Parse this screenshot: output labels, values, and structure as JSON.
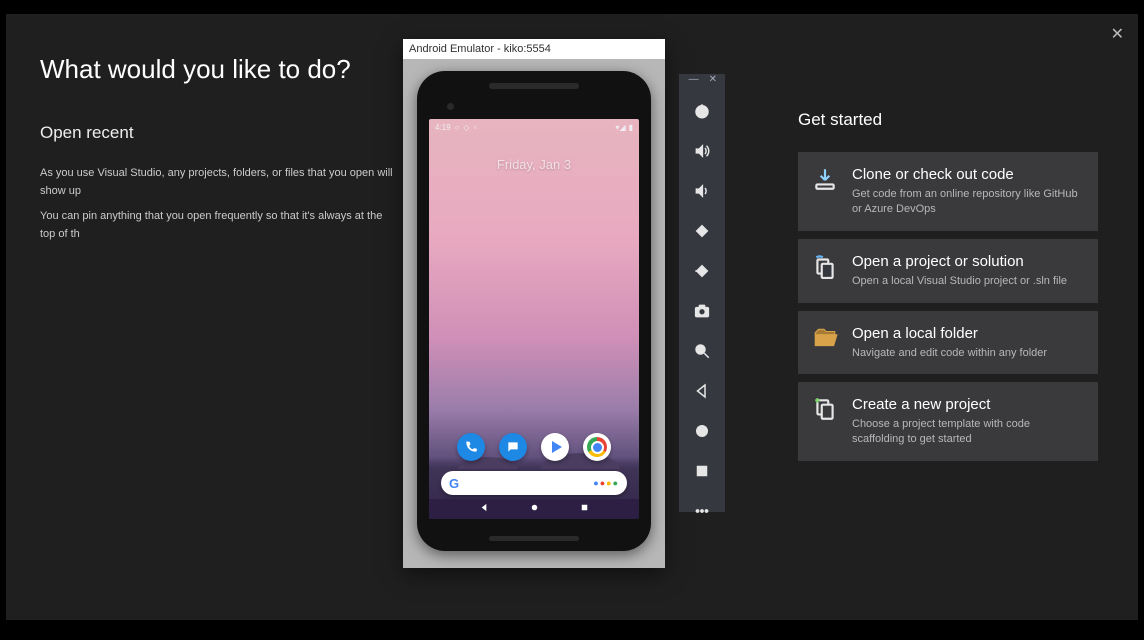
{
  "vs": {
    "title": "What would you like to do?",
    "recent_heading": "Open recent",
    "recent_p1": "As you use Visual Studio, any projects, folders, or files that you open will show up",
    "recent_p2": "You can pin anything that you open frequently so that it's always at the top of th",
    "get_started_heading": "Get started",
    "tiles": [
      {
        "title": "Clone or check out code",
        "sub": "Get code from an online repository like GitHub or Azure DevOps"
      },
      {
        "title": "Open a project or solution",
        "sub": "Open a local Visual Studio project or .sln file"
      },
      {
        "title": "Open a local folder",
        "sub": "Navigate and edit code within any folder"
      },
      {
        "title": "Create a new project",
        "sub": "Choose a project template with code scaffolding to get started"
      }
    ]
  },
  "emulator": {
    "window_title": "Android Emulator - kiko:5554",
    "status_time": "4:19",
    "date": "Friday, Jan 3"
  }
}
